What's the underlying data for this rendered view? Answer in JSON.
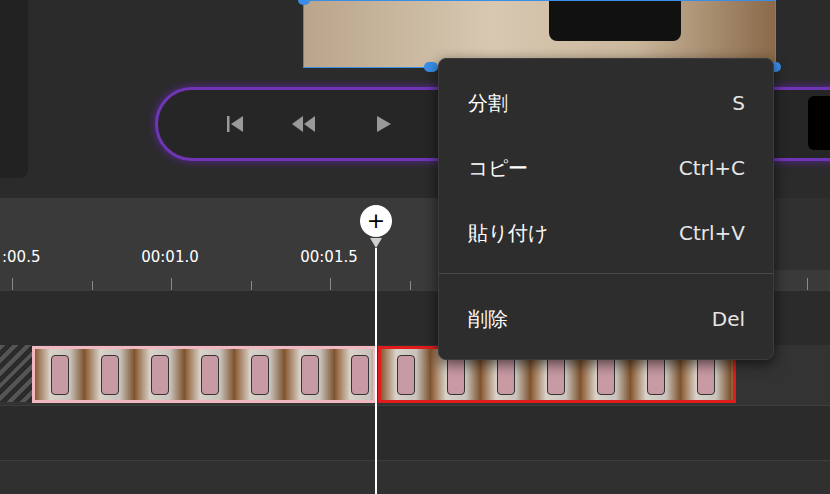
{
  "playhead": {
    "icon": "+"
  },
  "ruler": {
    "labels": [
      {
        "text": ":00.5"
      },
      {
        "text": "00:01.0"
      },
      {
        "text": "00:01.5"
      }
    ]
  },
  "clips": [
    {
      "selected": false
    },
    {
      "selected": true
    }
  ],
  "context_menu": {
    "groups": [
      [
        {
          "label": "分割",
          "shortcut": "S"
        },
        {
          "label": "コピー",
          "shortcut": "Ctrl+C"
        },
        {
          "label": "貼り付け",
          "shortcut": "Ctrl+V"
        }
      ],
      [
        {
          "label": "削除",
          "shortcut": "Del"
        }
      ]
    ]
  }
}
